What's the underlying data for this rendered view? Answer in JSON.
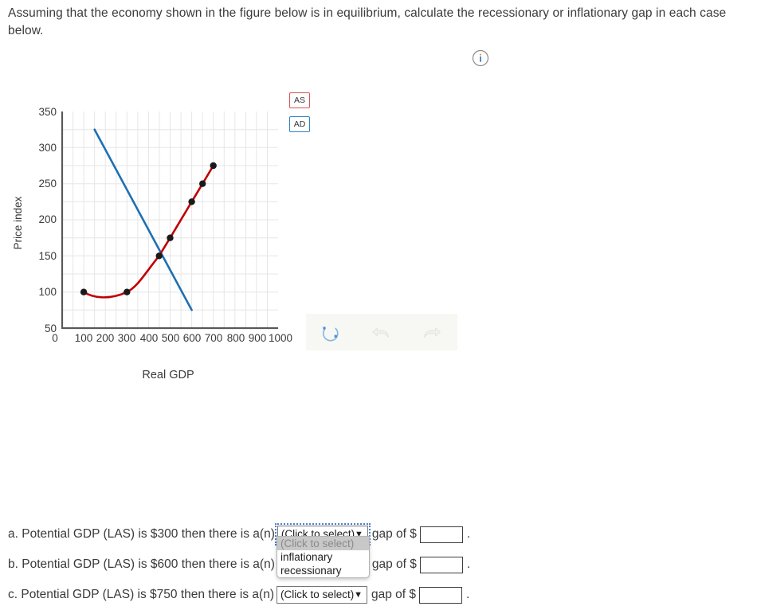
{
  "prompt": "Assuming that the economy shown in the figure below is in equilibrium, calculate the recessionary or inflationary gap in each case below.",
  "info_icon": "info-icon",
  "legend": [
    {
      "label": "AS",
      "color": "#d9534f"
    },
    {
      "label": "AD",
      "color": "#2f7fc1"
    }
  ],
  "toolbar": {
    "reset_icon": "reset-circular-arrow-icon",
    "undo_icon": "undo-arrow-icon",
    "redo_icon": "redo-arrow-icon",
    "reset_color": "#5b9bd5",
    "undo_color": "#ececeb",
    "redo_color": "#ececeb"
  },
  "chart_data": {
    "type": "line",
    "title": "",
    "xlabel": "Real GDP",
    "ylabel": "Price index",
    "xlim": [
      0,
      1000
    ],
    "ylim": [
      50,
      350
    ],
    "xticks": [
      0,
      100,
      200,
      300,
      400,
      500,
      600,
      700,
      800,
      900,
      1000
    ],
    "yticks": [
      50,
      100,
      150,
      200,
      250,
      300,
      350
    ],
    "grid": true,
    "legend_position": "outside-right-top",
    "series": [
      {
        "name": "AS",
        "color": "#c00000",
        "markers": true,
        "x": [
          100,
          300,
          450,
          500,
          600,
          650,
          700
        ],
        "y": [
          100,
          100,
          150,
          175,
          225,
          250,
          275
        ]
      },
      {
        "name": "AD",
        "color": "#1f6fb4",
        "markers": false,
        "x": [
          150,
          600
        ],
        "y": [
          325,
          75
        ]
      }
    ],
    "equilibrium": {
      "x": 450,
      "y": 150
    }
  },
  "questions": {
    "rows": [
      {
        "prefix": "a. Potential GDP (LAS) is $300 then there is a(n)",
        "select_value": "(Click to select)",
        "middle": "gap of $",
        "answer": "",
        "suffix": ".",
        "open": true,
        "focused": true
      },
      {
        "prefix": "b. Potential GDP (LAS) is $600 then there is a(n)",
        "select_value": "(Click to select)",
        "middle": "gap of $",
        "answer": "",
        "suffix": ".",
        "open": false,
        "focused": false
      },
      {
        "prefix": "c. Potential GDP (LAS) is $750 then there is a(n)",
        "select_value": "(Click to select)",
        "middle": "gap of $",
        "answer": "",
        "suffix": ".",
        "open": false,
        "focused": false
      }
    ],
    "dropdown_options": [
      "(Click to select)",
      "inflationary",
      "recessionary"
    ],
    "dropdown_highlighted_index": 0
  }
}
